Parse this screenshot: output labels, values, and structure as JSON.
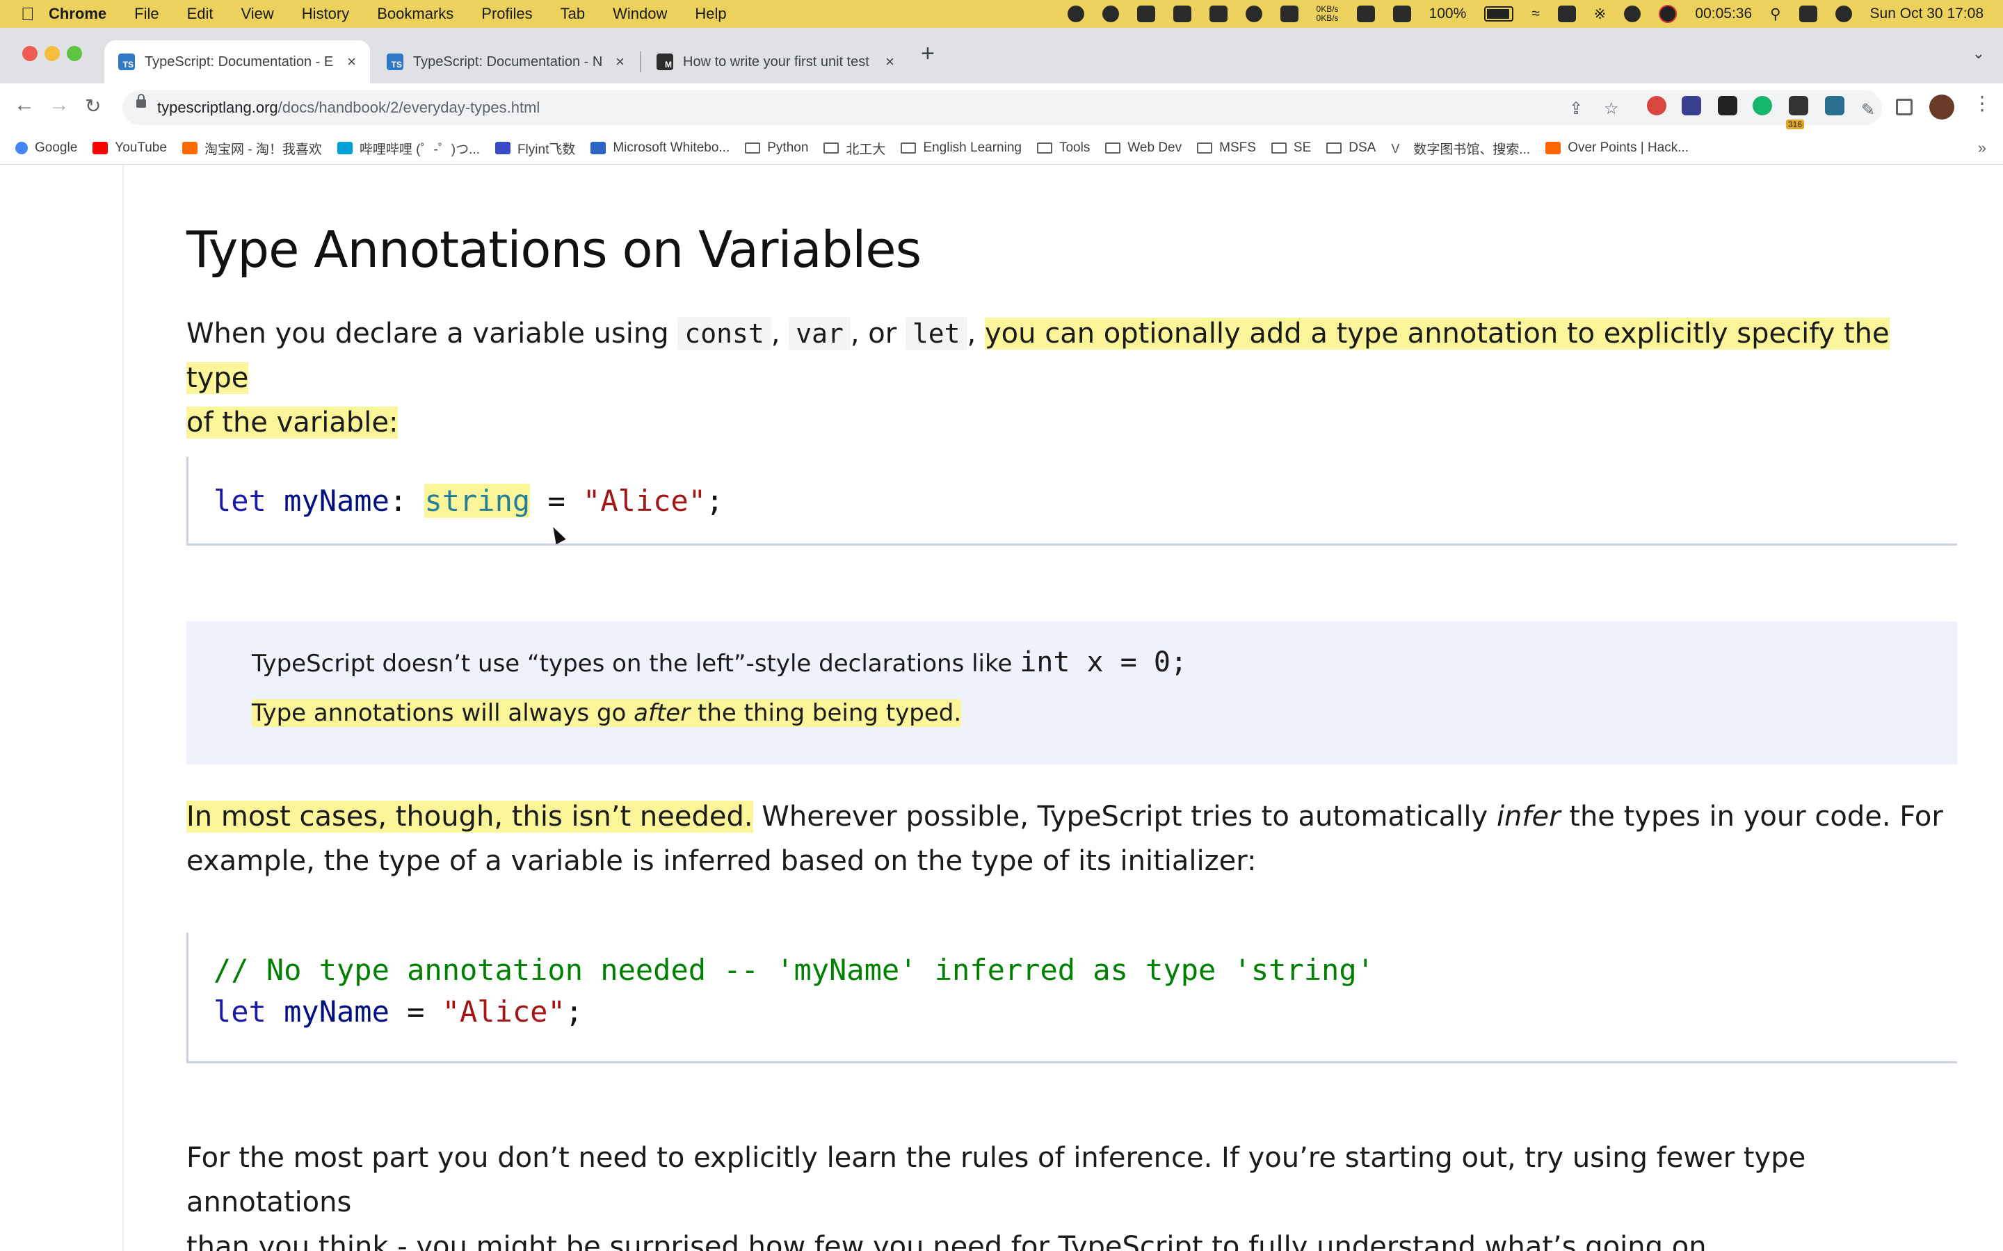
{
  "menubar": {
    "app": "Chrome",
    "items": [
      "File",
      "Edit",
      "View",
      "History",
      "Bookmarks",
      "Profiles",
      "Tab",
      "Window",
      "Help"
    ],
    "netspeed_up": "0KB/s",
    "netspeed_down": "0KB/s",
    "battery": "100%",
    "timer": "00:05:36",
    "datetime": "Sun Oct 30  17:08"
  },
  "tabs": [
    {
      "title": "TypeScript: Documentation - E",
      "favicon": "TS",
      "active": true
    },
    {
      "title": "TypeScript: Documentation - N",
      "favicon": "TS",
      "active": false
    },
    {
      "title": "How to write your first unit test",
      "favicon": "M",
      "active": false
    }
  ],
  "address": {
    "domain": "typescriptlang.org",
    "path": "/docs/handbook/2/everyday-types.html"
  },
  "bookmarks": [
    {
      "label": "Google",
      "icon": "google-icon"
    },
    {
      "label": "YouTube",
      "icon": "youtube-icon"
    },
    {
      "label": "淘宝网 - 淘！我喜欢",
      "icon": "taobao-icon"
    },
    {
      "label": "哔哩哔哩 (゜-゜)つ...",
      "icon": "bilibili-icon"
    },
    {
      "label": "Flyint飞数",
      "icon": "flyint-icon"
    },
    {
      "label": "Microsoft Whitebo...",
      "icon": "whiteboard-icon"
    },
    {
      "label": "Python",
      "icon": "folder-icon"
    },
    {
      "label": "北工大",
      "icon": "folder-icon"
    },
    {
      "label": "English Learning",
      "icon": "folder-icon"
    },
    {
      "label": "Tools",
      "icon": "folder-icon"
    },
    {
      "label": "Web Dev",
      "icon": "folder-icon"
    },
    {
      "label": "MSFS",
      "icon": "folder-icon"
    },
    {
      "label": "SE",
      "icon": "folder-icon"
    },
    {
      "label": "DSA",
      "icon": "folder-icon"
    },
    {
      "label": "数字图书馆、搜索...",
      "icon": "library-icon"
    },
    {
      "label": "Over Points | Hack...",
      "icon": "hackernews-icon"
    }
  ],
  "extensions": {
    "badge_count": "316"
  },
  "article": {
    "heading": "Type Annotations on Variables",
    "p1": {
      "t1": "When you declare a variable using ",
      "c1": "const",
      "t2": ", ",
      "c2": "var",
      "t3": ", or ",
      "c3": "let",
      "t4": ", ",
      "highlight_line1": "you can optionally add a type annotation to explicitly specify the type",
      "highlight_line2": "of the variable:"
    },
    "code1": {
      "kw": "let",
      "name": " myName",
      "colon": ": ",
      "type": "string",
      "eq": " = ",
      "str": "\"Alice\"",
      "end": ";"
    },
    "callout": {
      "line1_text": "TypeScript doesn’t use “types on the left”-style declarations like ",
      "line1_code": "int x = 0;",
      "line2_pre": "Type annotations will always go ",
      "line2_em": "after",
      "line2_post": " the thing being typed."
    },
    "p2": {
      "highlight": "In most cases, though, this isn’t needed.",
      "t1": " Wherever possible, TypeScript tries to automatically ",
      "em": "infer",
      "t2": " the types in your code. For",
      "line2": "example, the type of a variable is inferred based on the type of its initializer:"
    },
    "code2": {
      "comment": "// No type annotation needed -- 'myName' inferred as type 'string'",
      "kw": "let",
      "name": " myName",
      "eq": " = ",
      "str": "\"Alice\"",
      "end": ";"
    },
    "p3": {
      "line1": "For the most part you don’t need to explicitly learn the rules of inference. If you’re starting out, try using fewer type annotations",
      "line2": "than you think - you might be surprised how few you need for TypeScript to fully understand what’s going on."
    }
  }
}
